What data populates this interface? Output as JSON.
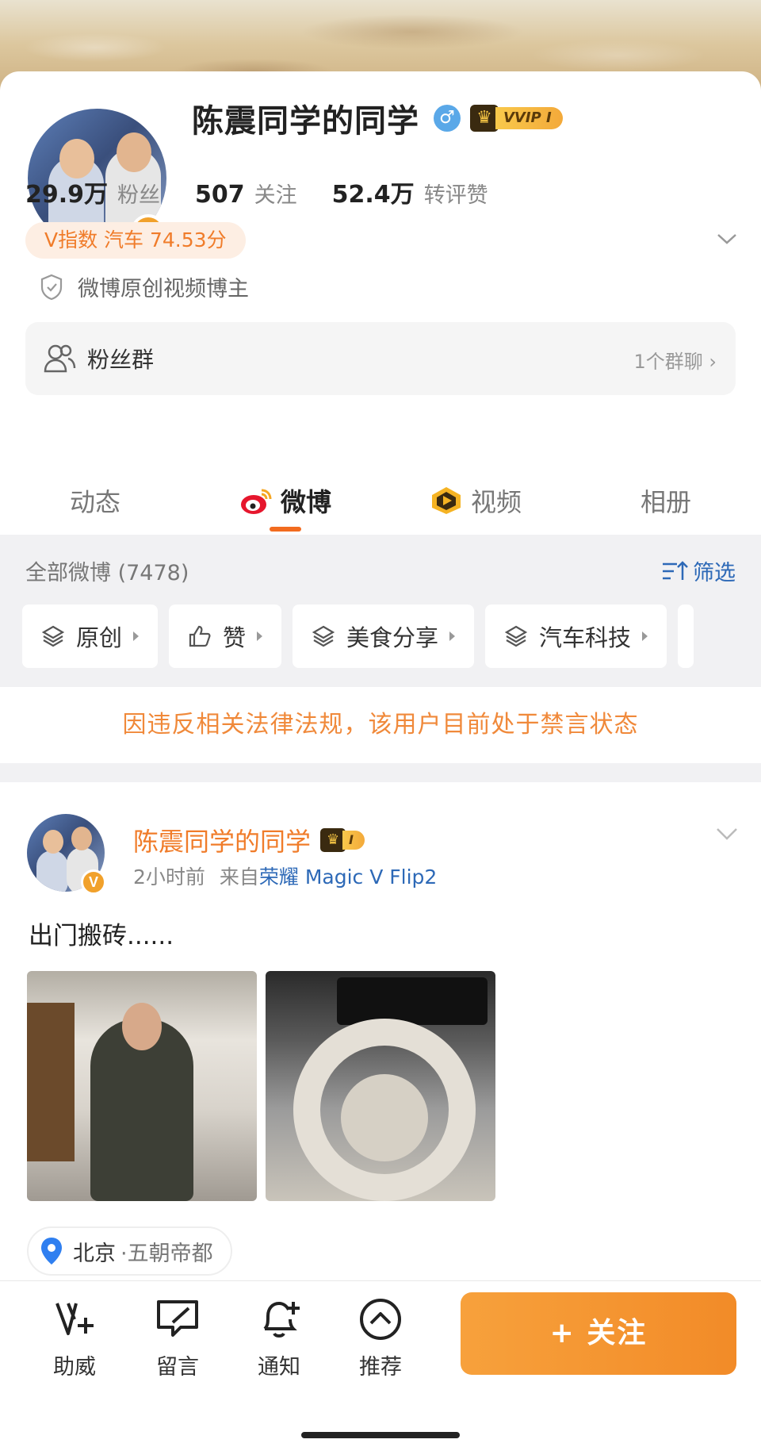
{
  "profile": {
    "name": "陈震同学的同学",
    "vip_label": "VVIP I",
    "stats": [
      {
        "num": "29.9万",
        "label": "粉丝"
      },
      {
        "num": "507",
        "label": "关注"
      },
      {
        "num": "52.4万",
        "label": "转评赞"
      }
    ],
    "v_index": "V指数 汽车 74.53分",
    "creator_tag": "微博原创视频博主",
    "fan_group": {
      "label": "粉丝群",
      "right": "1个群聊 ›"
    }
  },
  "tabs": [
    {
      "label": "动态"
    },
    {
      "label": "微博"
    },
    {
      "label": "视频"
    },
    {
      "label": "相册"
    }
  ],
  "filter": {
    "count": "全部微博 (7478)",
    "sift_label": "筛选",
    "chips": [
      {
        "label": "原创",
        "icon": "layers-icon"
      },
      {
        "label": "赞",
        "icon": "thumbs-up-icon"
      },
      {
        "label": "美食分享",
        "icon": "layers-icon"
      },
      {
        "label": "汽车科技",
        "icon": "layers-icon"
      }
    ]
  },
  "notice": "因违反相关法律法规，该用户目前处于禁言状态",
  "post": {
    "author": "陈震同学的同学",
    "vip_label": "I",
    "time": "2小时前",
    "from_prefix": "来自",
    "source": "荣耀 Magic V Flip2",
    "text": "出门搬砖......",
    "location_main": "北京",
    "location_sub": "·五朝帝都"
  },
  "bottom_nav": [
    {
      "label": "助威",
      "icon": "v-plus-icon"
    },
    {
      "label": "留言",
      "icon": "message-icon"
    },
    {
      "label": "通知",
      "icon": "bell-plus-icon"
    },
    {
      "label": "推荐",
      "icon": "chevron-up-circle-icon"
    }
  ],
  "follow_button": "+ 关注",
  "colors": {
    "accent": "#f07c2a",
    "link": "#2d69b7",
    "follow": "#f28b28"
  }
}
